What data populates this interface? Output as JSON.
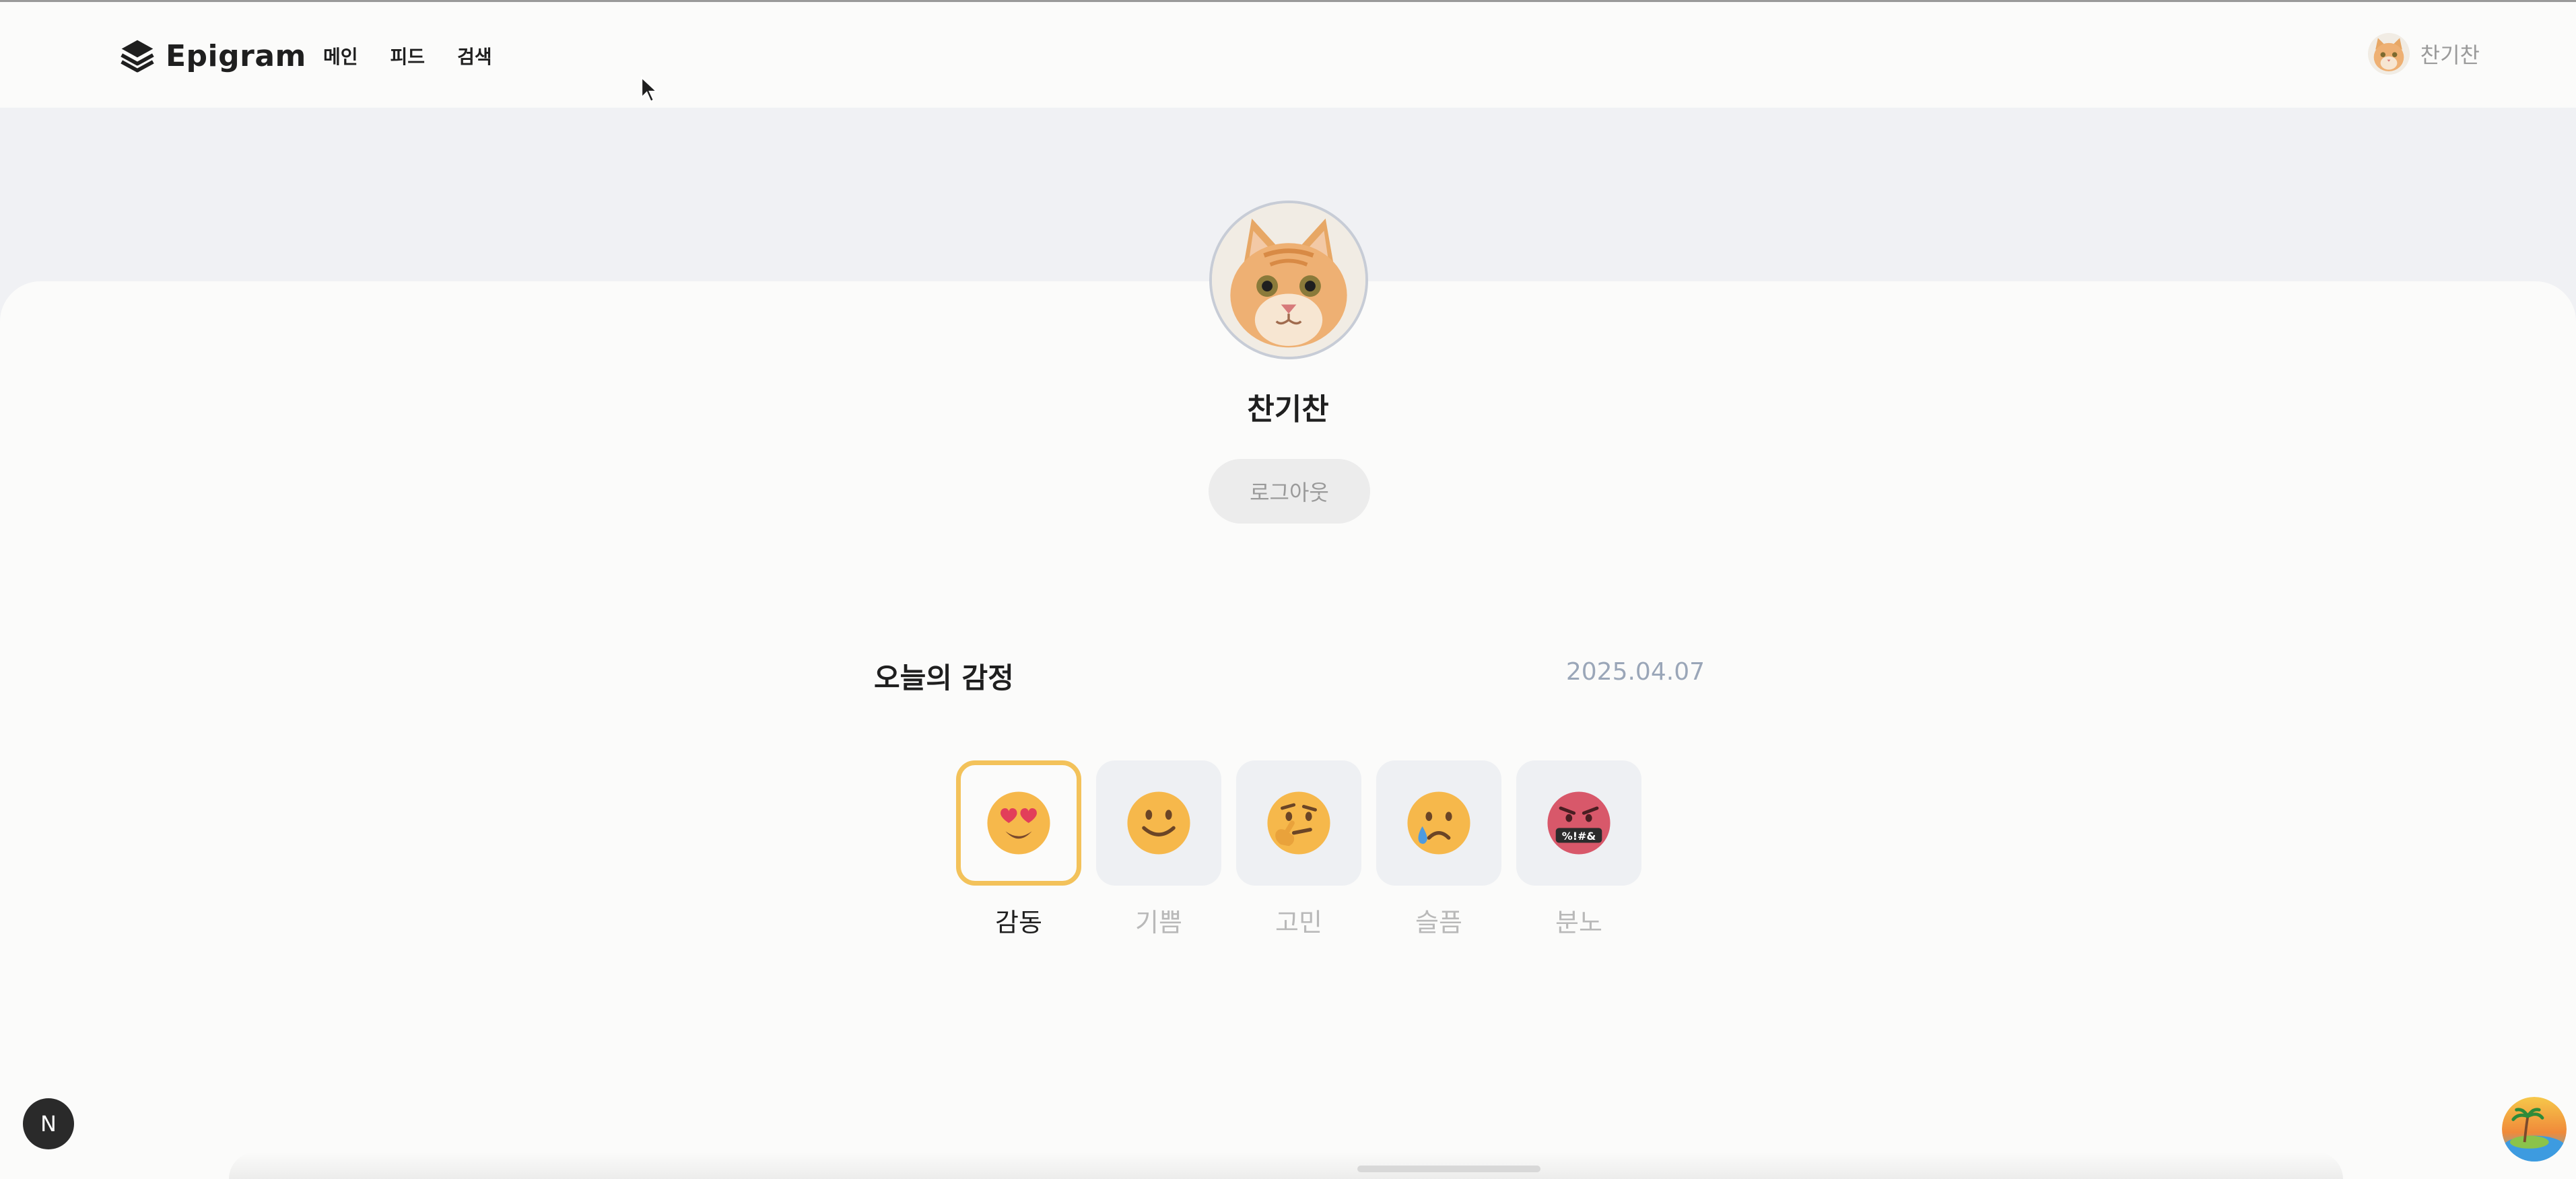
{
  "header": {
    "logo_text": "Epigram",
    "nav": [
      {
        "label": "메인"
      },
      {
        "label": "피드"
      },
      {
        "label": "검색"
      }
    ],
    "user_name": "찬기찬"
  },
  "profile": {
    "name": "찬기찬",
    "logout_label": "로그아웃"
  },
  "emotion_section": {
    "title": "오늘의 감정",
    "date": "2025.04.07",
    "selected": "감동",
    "items": [
      {
        "label": "감동",
        "icon": "heart-eyes-face-icon"
      },
      {
        "label": "기쁨",
        "icon": "smiling-face-icon"
      },
      {
        "label": "고민",
        "icon": "thinking-face-icon"
      },
      {
        "label": "슬픔",
        "icon": "sad-tear-face-icon"
      },
      {
        "label": "분노",
        "icon": "angry-cursing-face-icon"
      }
    ]
  },
  "overlays": {
    "dev_badge": "N"
  },
  "colors": {
    "accent": "#f3c25a",
    "muted_text": "#9a9a9a",
    "date_text": "#9aa6b8",
    "band": "#f0f1f4"
  }
}
